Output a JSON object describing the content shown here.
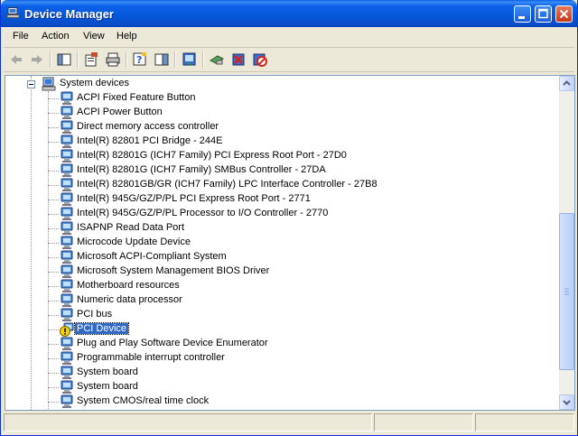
{
  "window": {
    "title": "Device Manager"
  },
  "menu": [
    {
      "id": "file",
      "label": "File"
    },
    {
      "id": "action",
      "label": "Action"
    },
    {
      "id": "view",
      "label": "View"
    },
    {
      "id": "help",
      "label": "Help"
    }
  ],
  "toolbar": {
    "buttons": [
      "back-icon",
      "forward-icon",
      "up-icon",
      "properties-icon",
      "print-icon",
      "help-icon",
      "console-tree-icon",
      "update-driver-icon",
      "scan-hardware-icon",
      "uninstall-icon",
      "disable-icon"
    ]
  },
  "tree": {
    "category": {
      "label": "System devices",
      "icon": "computer-icon",
      "expanded": true
    },
    "devices": [
      {
        "label": "ACPI Fixed Feature Button",
        "icon": "device-icon",
        "status": "ok"
      },
      {
        "label": "ACPI Power Button",
        "icon": "device-icon",
        "status": "ok"
      },
      {
        "label": "Direct memory access controller",
        "icon": "device-icon",
        "status": "ok"
      },
      {
        "label": "Intel(R) 82801 PCI Bridge - 244E",
        "icon": "device-icon",
        "status": "ok"
      },
      {
        "label": "Intel(R) 82801G (ICH7 Family) PCI Express Root Port - 27D0",
        "icon": "device-icon",
        "status": "ok"
      },
      {
        "label": "Intel(R) 82801G (ICH7 Family) SMBus Controller - 27DA",
        "icon": "device-icon",
        "status": "ok"
      },
      {
        "label": "Intel(R) 82801GB/GR (ICH7 Family) LPC Interface Controller - 27B8",
        "icon": "device-icon",
        "status": "ok"
      },
      {
        "label": "Intel(R) 945G/GZ/P/PL PCI Express Root Port - 2771",
        "icon": "device-icon",
        "status": "ok"
      },
      {
        "label": "Intel(R) 945G/GZ/P/PL Processor to I/O Controller - 2770",
        "icon": "device-icon",
        "status": "ok"
      },
      {
        "label": "ISAPNP Read Data Port",
        "icon": "device-icon",
        "status": "ok"
      },
      {
        "label": "Microcode Update Device",
        "icon": "device-icon",
        "status": "ok"
      },
      {
        "label": "Microsoft ACPI-Compliant System",
        "icon": "device-icon",
        "status": "ok"
      },
      {
        "label": "Microsoft System Management BIOS Driver",
        "icon": "device-icon",
        "status": "ok"
      },
      {
        "label": "Motherboard resources",
        "icon": "device-icon",
        "status": "ok"
      },
      {
        "label": "Numeric data processor",
        "icon": "device-icon",
        "status": "ok"
      },
      {
        "label": "PCI bus",
        "icon": "device-icon",
        "status": "ok"
      },
      {
        "label": "PCI Device",
        "icon": "warning-icon",
        "status": "warning",
        "selected": true
      },
      {
        "label": "Plug and Play Software Device Enumerator",
        "icon": "device-icon",
        "status": "ok"
      },
      {
        "label": "Programmable interrupt controller",
        "icon": "device-icon",
        "status": "ok"
      },
      {
        "label": "System board",
        "icon": "device-icon",
        "status": "ok"
      },
      {
        "label": "System board",
        "icon": "device-icon",
        "status": "ok"
      },
      {
        "label": "System CMOS/real time clock",
        "icon": "device-icon",
        "status": "ok"
      }
    ]
  },
  "colors": {
    "selection": "#316ac5",
    "titlebar": "#0a5fe6",
    "warning": "#f5d300"
  },
  "status": {
    "panes": [
      "",
      "",
      ""
    ]
  }
}
